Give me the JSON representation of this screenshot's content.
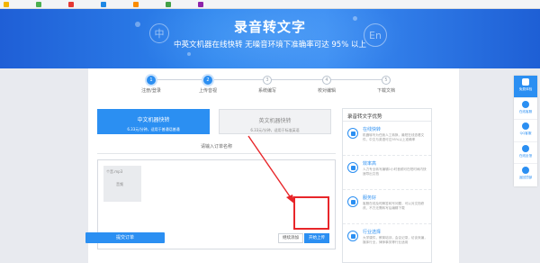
{
  "hero": {
    "title": "录音转文字",
    "subtitle": "中英文机器在线快转    无噪音环境下准确率可达 95% 以上",
    "bubble_left": "中",
    "bubble_right": "En"
  },
  "steps": [
    {
      "num": "1",
      "label": "注册/登录",
      "active": true
    },
    {
      "num": "2",
      "label": "上传音视",
      "active": true
    },
    {
      "num": "3",
      "label": "系统编写",
      "active": false
    },
    {
      "num": "4",
      "label": "校对编辑",
      "active": false
    },
    {
      "num": "5",
      "label": "下载文档",
      "active": false
    }
  ],
  "tabs": [
    {
      "title": "中文机器快转",
      "desc": "6.33元/分钟，适用于普通话普通"
    },
    {
      "title": "英文机器快转",
      "desc": "6.33元/分钟，适用于标准英语"
    }
  ],
  "order_name_placeholder": "请输入订单名称",
  "upload": {
    "file_name": "个音.mp3",
    "file_thumb": "音频",
    "hint": "共4个音频，时长2.5分钟。",
    "select_button": "继续添加",
    "upload_button": "开始上传"
  },
  "submit_button": "提交订单",
  "advantages": {
    "title": "录音转文字优势",
    "items": [
      {
        "title": "在线快转",
        "desc": "机器转写为任我人工转换，最短在线查看文件，中文与英语可达95%以上准确率"
      },
      {
        "title": "效率高",
        "desc": "人力专业转写编辑1小时音频可在短时间内快速导出文档"
      },
      {
        "title": "服务好",
        "desc": "客服在线及时解答转写问题，可以对文档修改，不方无需转写后编辑下载"
      },
      {
        "title": "行业选择",
        "desc": "大学课件，教育培训，会议记录，访谈采编，媒体行业，律师事务等行业适用"
      }
    ]
  },
  "sidebar": [
    {
      "label": "免费体验",
      "icon": "gift-icon",
      "active": true
    },
    {
      "label": "在线客服",
      "icon": "chat-icon",
      "active": false
    },
    {
      "label": "QQ客服",
      "icon": "qq-icon",
      "active": false
    },
    {
      "label": "在线反馈",
      "icon": "feedback-icon",
      "active": false
    },
    {
      "label": "返回顶部",
      "icon": "arrow-up-icon",
      "active": false
    }
  ],
  "colors": {
    "accent": "#2b8ff2",
    "hero": "#2a7be8",
    "annotation": "#e8262a"
  }
}
